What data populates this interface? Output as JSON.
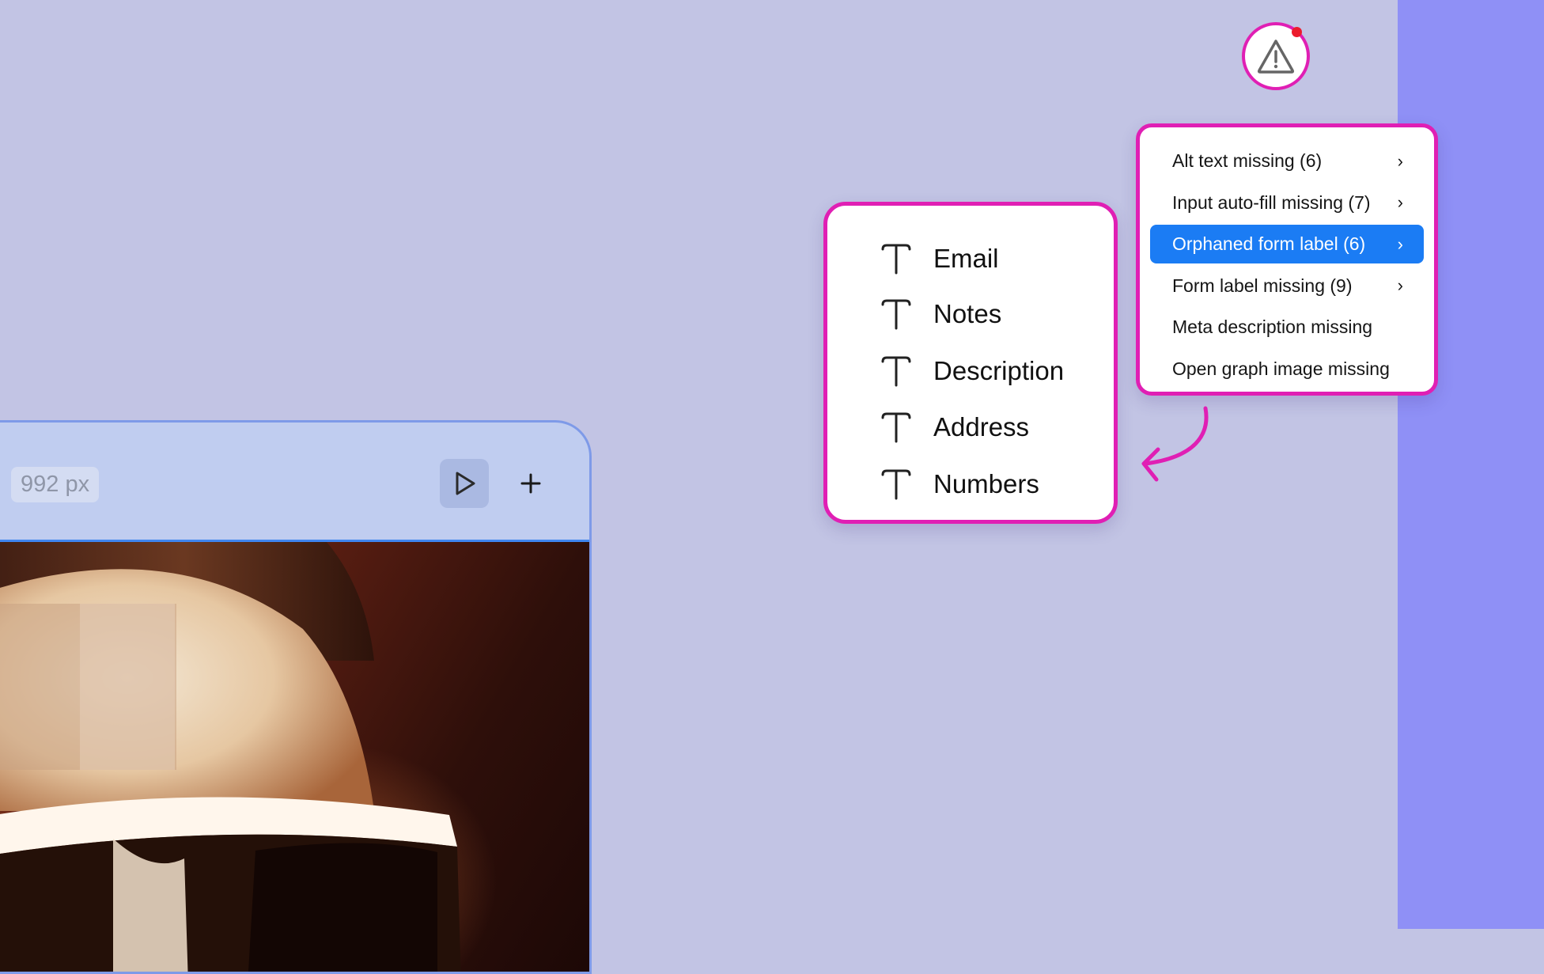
{
  "warning": {
    "icon": "warning-triangle-icon",
    "has_notification": true,
    "accent_color": "#e01fb4",
    "dot_color": "#ec1c2c"
  },
  "issues_menu": {
    "items": [
      {
        "label": "Alt text missing (6)",
        "has_submenu": true,
        "active": false
      },
      {
        "label": "Input auto-fill missing (7)",
        "has_submenu": true,
        "active": false
      },
      {
        "label": "Orphaned form label (6)",
        "has_submenu": true,
        "active": true
      },
      {
        "label": "Form label missing (9)",
        "has_submenu": true,
        "active": false
      },
      {
        "label": "Meta description missing",
        "has_submenu": false,
        "active": false
      },
      {
        "label": "Open graph image missing",
        "has_submenu": false,
        "active": false
      }
    ],
    "chevron": "›",
    "active_color": "#1b7cf4"
  },
  "fields_popup": {
    "items": [
      {
        "label": "Email",
        "icon": "text-type-icon"
      },
      {
        "label": "Notes",
        "icon": "text-type-icon"
      },
      {
        "label": "Description",
        "icon": "text-type-icon"
      },
      {
        "label": "Address",
        "icon": "text-type-icon"
      },
      {
        "label": "Numbers",
        "icon": "text-type-icon"
      }
    ]
  },
  "canvas": {
    "width_label": "992 px",
    "play_icon": "play-icon",
    "add_icon": "plus-icon"
  },
  "colors": {
    "background": "#c2c4e4",
    "right_strip": "#8f90f6",
    "highlight_border": "#e01fb4",
    "frame_border": "#7e9ae8"
  }
}
